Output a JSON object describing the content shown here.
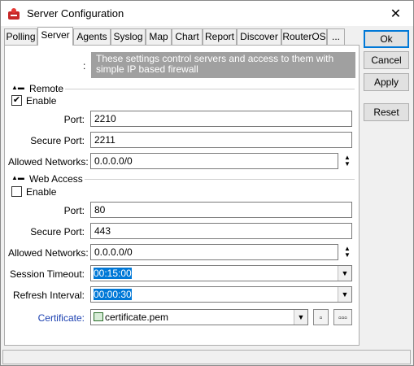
{
  "window": {
    "title": "Server Configuration",
    "close_glyph": "✕"
  },
  "tabs": [
    {
      "label": "Polling",
      "active": false
    },
    {
      "label": "Server",
      "active": true
    },
    {
      "label": "Agents",
      "active": false
    },
    {
      "label": "Syslog",
      "active": false
    },
    {
      "label": "Map",
      "active": false
    },
    {
      "label": "Chart",
      "active": false
    },
    {
      "label": "Report",
      "active": false
    },
    {
      "label": "Discover",
      "active": false
    },
    {
      "label": "RouterOS",
      "active": false
    },
    {
      "label": "...",
      "active": false
    }
  ],
  "info": {
    "colon": ":",
    "text": "These settings control servers and access to them with simple IP based firewall"
  },
  "remote": {
    "title": "Remote",
    "enable_label": "Enable",
    "enable_checked": true,
    "port_label": "Port:",
    "port_value": "2210",
    "secure_port_label": "Secure Port:",
    "secure_port_value": "2211",
    "allowed_networks_label": "Allowed Networks:",
    "allowed_networks_value": "0.0.0.0/0"
  },
  "web_access": {
    "title": "Web Access",
    "enable_label": "Enable",
    "enable_checked": false,
    "port_label": "Port:",
    "port_value": "80",
    "secure_port_label": "Secure Port:",
    "secure_port_value": "443",
    "allowed_networks_label": "Allowed Networks:",
    "allowed_networks_value": "0.0.0.0/0",
    "session_timeout_label": "Session Timeout:",
    "session_timeout_value": "00:15:00",
    "refresh_interval_label": "Refresh Interval:",
    "refresh_interval_value": "00:00:30",
    "certificate_label": "Certificate:",
    "certificate_value": "certificate.pem"
  },
  "buttons": {
    "ok": "Ok",
    "cancel": "Cancel",
    "apply": "Apply",
    "reset": "Reset"
  },
  "glyphs": {
    "collapse": "▲▬",
    "check": "✔",
    "dropdown": "▼",
    "spinner_up": "▲",
    "spinner_down": "▼",
    "cert_small_btn": "▫",
    "cert_more_btn": "▫▫▫"
  },
  "colors": {
    "selection": "#0078d7",
    "link": "#1a3fb0",
    "info_bg": "#a0a0a0"
  },
  "icons": {
    "app": "router-app-icon",
    "certificate": "certificate-icon"
  }
}
